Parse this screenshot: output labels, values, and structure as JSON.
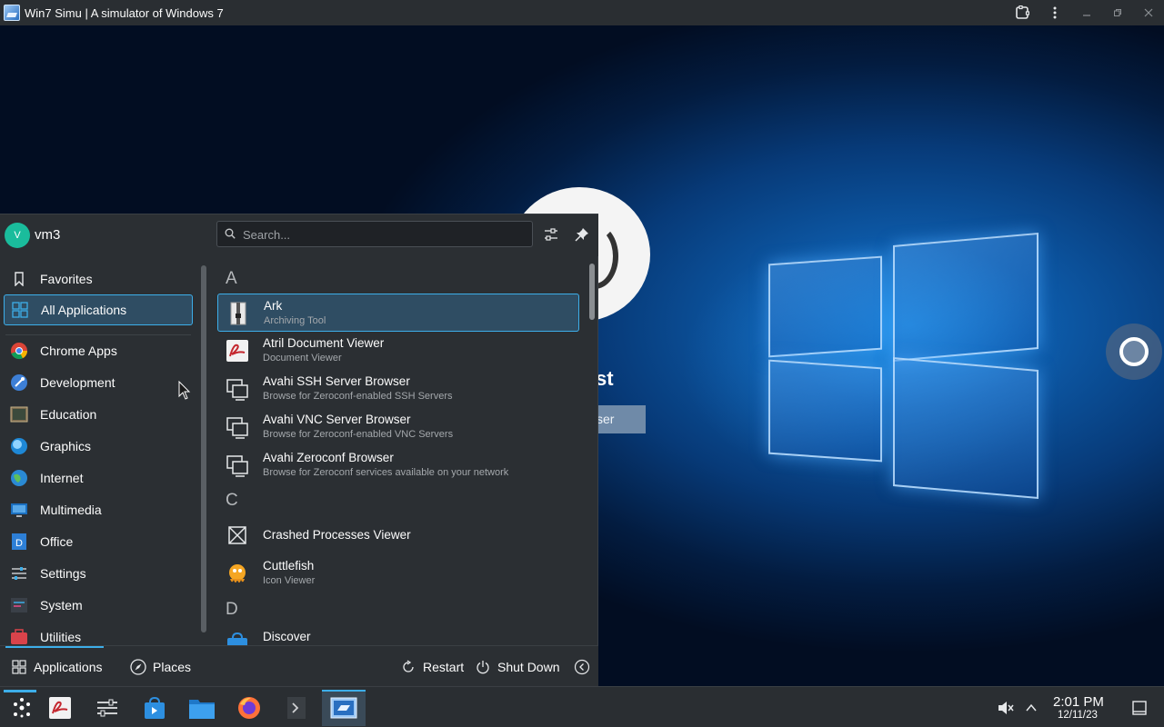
{
  "window": {
    "title": "Win7 Simu | A simulator of Windows 7",
    "icons": [
      "app-icon",
      "screenshot-icon",
      "menu-kebab-icon",
      "minimize-icon",
      "restore-icon",
      "close-icon"
    ]
  },
  "login": {
    "name_fragment": "st",
    "button_fragment": "ser"
  },
  "launcher": {
    "user": {
      "initial": "V",
      "name": "vm3"
    },
    "search": {
      "placeholder": "Search..."
    },
    "categories": [
      {
        "label": "Favorites",
        "icon": "bookmark-icon"
      },
      {
        "label": "All Applications",
        "icon": "grid-icon",
        "active": true
      },
      {
        "label": "Chrome Apps",
        "icon": "chrome-icon"
      },
      {
        "label": "Development",
        "icon": "development-icon"
      },
      {
        "label": "Education",
        "icon": "education-icon"
      },
      {
        "label": "Graphics",
        "icon": "graphics-icon"
      },
      {
        "label": "Internet",
        "icon": "internet-icon"
      },
      {
        "label": "Multimedia",
        "icon": "multimedia-icon"
      },
      {
        "label": "Office",
        "icon": "office-icon"
      },
      {
        "label": "Settings",
        "icon": "settings-icon"
      },
      {
        "label": "System",
        "icon": "system-icon"
      },
      {
        "label": "Utilities",
        "icon": "utilities-icon"
      }
    ],
    "sections": [
      "A",
      "C",
      "D"
    ],
    "apps": [
      {
        "name": "Ark",
        "desc": "Archiving Tool",
        "icon": "archive-icon",
        "active": true
      },
      {
        "name": "Atril Document Viewer",
        "desc": "Document Viewer",
        "icon": "pdf-icon"
      },
      {
        "name": "Avahi SSH Server Browser",
        "desc": "Browse for Zeroconf-enabled SSH Servers",
        "icon": "network-icon"
      },
      {
        "name": "Avahi VNC Server Browser",
        "desc": "Browse for Zeroconf-enabled VNC Servers",
        "icon": "network-icon"
      },
      {
        "name": "Avahi Zeroconf Browser",
        "desc": "Browse for Zeroconf services available on your network",
        "icon": "network-icon"
      },
      {
        "name": "Crashed Processes Viewer",
        "desc": "",
        "icon": "crash-icon"
      },
      {
        "name": "Cuttlefish",
        "desc": "Icon Viewer",
        "icon": "cuttlefish-icon"
      },
      {
        "name": "Discover",
        "desc": "",
        "icon": "store-icon"
      }
    ],
    "footer": {
      "applications": "Applications",
      "places": "Places",
      "restart": "Restart",
      "shutdown": "Shut Down"
    }
  },
  "taskbar": {
    "items": [
      "launcher-icon",
      "pdf-icon",
      "settings-icon",
      "store-icon",
      "files-icon",
      "firefox-icon",
      "terminal-icon",
      "win7simu-icon"
    ],
    "clock": {
      "time": "2:01 PM",
      "date": "12/11/23"
    }
  }
}
